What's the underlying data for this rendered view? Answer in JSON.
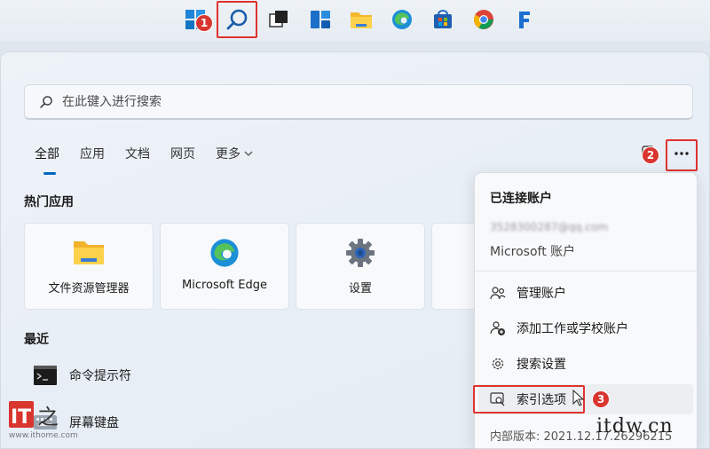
{
  "taskbar": {
    "badges": {
      "search": "1"
    }
  },
  "search": {
    "placeholder": "在此键入进行搜索"
  },
  "tabs": [
    {
      "label": "全部"
    },
    {
      "label": "应用"
    },
    {
      "label": "文档"
    },
    {
      "label": "网页"
    },
    {
      "label": "更多"
    }
  ],
  "header_badges": {
    "more": "2"
  },
  "sections": {
    "top_apps": "热门应用",
    "recent": "最近"
  },
  "top_apps": [
    {
      "label": "文件资源管理器",
      "icon": "folder-icon"
    },
    {
      "label": "Microsoft Edge",
      "icon": "edge-icon"
    },
    {
      "label": "设置",
      "icon": "settings-gear-icon"
    }
  ],
  "recent": [
    {
      "label": "命令提示符",
      "icon": "command-prompt-icon"
    },
    {
      "label": "屏幕键盘",
      "icon": "keyboard-icon"
    }
  ],
  "menu": {
    "header": "已连接账户",
    "email": "3528300287@qq.com",
    "account": "Microsoft 账户",
    "items": [
      {
        "label": "管理账户",
        "icon": "manage-accounts-icon"
      },
      {
        "label": "添加工作或学校账户",
        "icon": "add-account-icon"
      },
      {
        "label": "搜索设置",
        "icon": "gear-icon"
      },
      {
        "label": "索引选项",
        "icon": "index-options-icon"
      }
    ],
    "item_badge": "3",
    "version": "内部版本: 2021.12.17.26296215"
  },
  "watermark": {
    "url": "www.ithome.com",
    "logo": "IT之家",
    "brand": "itdw.cn"
  },
  "colors": {
    "accent": "#0067c0",
    "highlight": "#e0322f",
    "badge": "#d9352f"
  }
}
